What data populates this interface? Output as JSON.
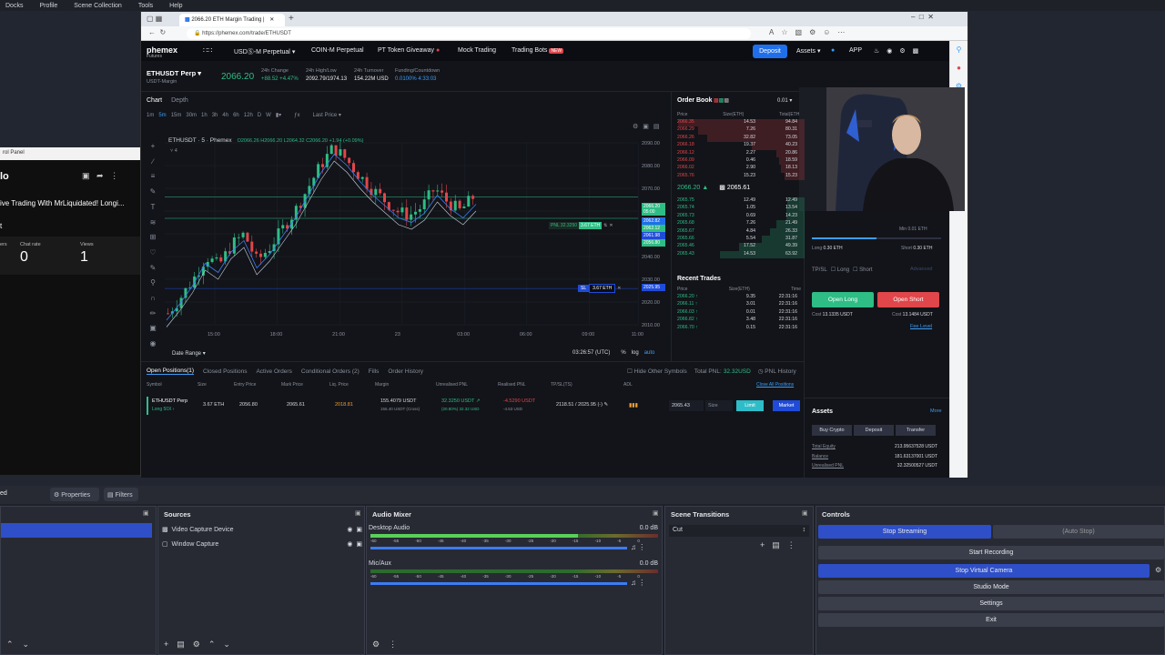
{
  "obs_menu": [
    "Docks",
    "Profile",
    "Scene Collection",
    "Tools",
    "Help"
  ],
  "left_window": {
    "control_panel": "rol Panel",
    "title_initial": "lo",
    "stream_title": "ive Trading With MrLiquidated! Longi...",
    "sub": "t",
    "stats": [
      {
        "label": "ers",
        "value": ""
      },
      {
        "label": "Chat rate",
        "value": "0"
      },
      {
        "label": "Views",
        "value": "1"
      }
    ]
  },
  "browser": {
    "tab_title": "2066.20 ETH Margin Trading |",
    "url": "https://phemex.com/trade/ETHUSDT"
  },
  "nav": {
    "logo": "phemex",
    "logo_sub": "Futures",
    "items": [
      "USDⓈ-M Perpetual",
      "COIN-M Perpetual",
      "PT Token Giveaway",
      "Mock Trading",
      "Trading Bots"
    ],
    "new_badge": "NEW",
    "deposit": "Deposit",
    "assets": "Assets",
    "app": "APP"
  },
  "ticker": {
    "symbol": "ETHUSDT Perp",
    "margin": "USDT-Margin",
    "price": "2066.20",
    "stats": [
      {
        "label": "24h Change",
        "value": "+88.52 +4.47%",
        "color": "#2ebd85"
      },
      {
        "label": "24h High/Low",
        "value": "2092.79/1974.13",
        "color": "#e8eaef"
      },
      {
        "label": "24h Turnover",
        "value": "154.22M USD",
        "color": "#e8eaef"
      },
      {
        "label": "Funding/Countdown",
        "value": "0.0100% 4:33:03",
        "color": "#3d9cf5"
      }
    ]
  },
  "chart": {
    "tabs": [
      "Chart",
      "Depth"
    ],
    "intervals": [
      "1m",
      "5m",
      "15m",
      "30m",
      "1h",
      "3h",
      "4h",
      "6h",
      "12h",
      "D",
      "W"
    ],
    "price_type": "Last Price",
    "legend_title": "ETHUSDT · 5 · Phemex",
    "ohlc": "O2066.26 H2066.20 L2064.32 C2066.20 +1.94 (+0.09%)",
    "legend_count": "4",
    "date_range": "Date Range",
    "clock": "03:26:57 (UTC)",
    "opts": [
      "%",
      "log",
      "auto"
    ],
    "pnl_tag": "PNL 32.3250",
    "pnl_size": "3.67 ETH",
    "sl_tag": "SL",
    "sl_size": "3.67 ETH",
    "last_price_tag": "2066.20",
    "last_price_sub": "05:00",
    "tags": [
      "2062.82",
      "2062.12",
      "2061.98",
      "2056.80",
      "2025.95"
    ],
    "chart_data": {
      "type": "line",
      "x": [
        "15:00",
        "18:00",
        "21:00",
        "23",
        "03:00",
        "06:00",
        "09:00",
        "11:00"
      ],
      "ylim": [
        2010,
        2090
      ],
      "yticks": [
        2010.0,
        2020.0,
        2030.0,
        2040.0,
        2050.0,
        2060.0,
        2070.0,
        2080.0,
        2090.0
      ],
      "series": [
        {
          "values": [
            2015,
            2022,
            2030,
            2040,
            2036,
            2045,
            2050,
            2038,
            2044,
            2052,
            2060,
            2070,
            2080,
            2088,
            2083,
            2076,
            2070,
            2065,
            2060,
            2058,
            2062,
            2070,
            2064,
            2060,
            2066
          ]
        }
      ]
    }
  },
  "orderbook": {
    "title": "Order Book",
    "precision": "0.01",
    "headers": [
      "Price",
      "Size(ETH)",
      "Total(ETH)"
    ],
    "asks": [
      {
        "price": "2066.35",
        "size": "14.53",
        "total": "94.84",
        "fill": 0.95
      },
      {
        "price": "2066.29",
        "size": "7.26",
        "total": "80.31",
        "fill": 0.8
      },
      {
        "price": "2066.26",
        "size": "32.82",
        "total": "73.05",
        "fill": 0.73
      },
      {
        "price": "2066.18",
        "size": "19.37",
        "total": "40.23",
        "fill": 0.4
      },
      {
        "price": "2066.12",
        "size": "2.27",
        "total": "20.86",
        "fill": 0.21
      },
      {
        "price": "2066.09",
        "size": "0.46",
        "total": "18.59",
        "fill": 0.19
      },
      {
        "price": "2066.02",
        "size": "2.90",
        "total": "18.13",
        "fill": 0.18
      },
      {
        "price": "2065.76",
        "size": "15.23",
        "total": "15.23",
        "fill": 0.15
      }
    ],
    "mid": "2066.20",
    "mark": "2065.61",
    "bids": [
      {
        "price": "2065.75",
        "size": "12.49",
        "total": "12.49",
        "fill": 0.13
      },
      {
        "price": "2065.74",
        "size": "1.05",
        "total": "13.54",
        "fill": 0.14
      },
      {
        "price": "2065.73",
        "size": "0.69",
        "total": "14.23",
        "fill": 0.14
      },
      {
        "price": "2065.68",
        "size": "7.26",
        "total": "21.49",
        "fill": 0.21
      },
      {
        "price": "2065.67",
        "size": "4.84",
        "total": "26.33",
        "fill": 0.26
      },
      {
        "price": "2065.66",
        "size": "5.54",
        "total": "31.87",
        "fill": 0.32
      },
      {
        "price": "2065.46",
        "size": "17.52",
        "total": "49.39",
        "fill": 0.49
      },
      {
        "price": "2065.43",
        "size": "14.53",
        "total": "63.92",
        "fill": 0.64
      }
    ],
    "recent_title": "Recent Trades",
    "recent_headers": [
      "Price",
      "Size(ETH)",
      "Time"
    ],
    "recent": [
      {
        "price": "2066.20",
        "size": "9.35",
        "time": "22:31:16"
      },
      {
        "price": "2066.11",
        "size": "3.01",
        "time": "22:31:16"
      },
      {
        "price": "2066.03",
        "size": "0.01",
        "time": "22:31:16"
      },
      {
        "price": "2066.82",
        "size": "3.48",
        "time": "22:31:16"
      },
      {
        "price": "2066.70",
        "size": "0.15",
        "time": "22:31:16"
      }
    ]
  },
  "trade_panel": {
    "min_qty": "Min 0.01 ETH",
    "long_label": "Long",
    "long_val": "0.30 ETH",
    "short_label": "Short",
    "short_val": "0.30 ETH",
    "tpsl": "TP/SL",
    "long_cb": "Long",
    "short_cb": "Short",
    "advanced": "Advanced",
    "open_long": "Open Long",
    "open_short": "Open Short",
    "cost_long_label": "Cost",
    "cost_long": "13.1335 USDT",
    "cost_short_label": "Cost",
    "cost_short": "13.1484 USDT",
    "fee_level": "Fee Level",
    "assets_title": "Assets",
    "more": "More",
    "asset_btns": [
      "Buy Crypto",
      "Deposit",
      "Transfer"
    ],
    "asset_rows": [
      {
        "label": "Total Equity",
        "value": "213.95637528 USDT"
      },
      {
        "label": "Balance",
        "value": "181.63137001 USDT"
      },
      {
        "label": "Unrealised PNL",
        "value": "32.32500527 USDT"
      }
    ],
    "slider_fraction": 0.5
  },
  "positions": {
    "tabs": [
      "Open Positions(1)",
      "Closed Positions",
      "Active Orders",
      "Conditional Orders (2)",
      "Fills",
      "Order History"
    ],
    "hide_other": "Hide Other Symbols",
    "total_pnl_label": "Total PNL:",
    "total_pnl": "32.32USD",
    "pnl_history": "PNL History",
    "headers": [
      "Symbol",
      "Size",
      "Entry Price",
      "Mark Price",
      "Liq. Price",
      "Margin",
      "Unrealised PNL",
      "Realised PNL",
      "TP/SL(TS)",
      "ADL"
    ],
    "close_all": "Close All Positions",
    "row": {
      "symbol": "ETHUSDT Perp",
      "side": "Long 50X",
      "size": "3.67 ETH",
      "entry": "2056.80",
      "mark": "2065.61",
      "liq": "2018.81",
      "margin": "155.4079 USDT",
      "margin_sub": "155.40 USDT (Cross)",
      "upnl": "32.3250 USDT",
      "upnl_sub": "(20.80%) 32.32 USD",
      "rpnl": "-4.5290 USDT",
      "rpnl_sub": "-4.53 USD",
      "tpsl": "2118.51 / 2025.95 (-)",
      "price_input": "2065.43",
      "size_placeholder": "Size",
      "limit": "Limit",
      "market": "Market"
    }
  },
  "obs": {
    "dock_tabs": [
      "ed",
      "Properties",
      "Filters"
    ],
    "sources_title": "Sources",
    "sources": [
      "Video Capture Device",
      "Window Capture"
    ],
    "mixer_title": "Audio Mixer",
    "channels": [
      {
        "name": "Desktop Audio",
        "db": "0.0 dB",
        "level": 0.72
      },
      {
        "name": "Mic/Aux",
        "db": "0.0 dB",
        "level": 0.0
      }
    ],
    "scale": [
      "-60",
      "-55",
      "-50",
      "-45",
      "-40",
      "-35",
      "-30",
      "-25",
      "-20",
      "-15",
      "-10",
      "-5",
      "0"
    ],
    "transitions_title": "Scene Transitions",
    "transition": "Cut",
    "controls_title": "Controls",
    "stop_streaming": "Stop Streaming",
    "auto_stop": "(Auto Stop)",
    "start_recording": "Start Recording",
    "stop_virtual": "Stop Virtual Camera",
    "studio_mode": "Studio Mode",
    "settings": "Settings",
    "exit": "Exit"
  }
}
